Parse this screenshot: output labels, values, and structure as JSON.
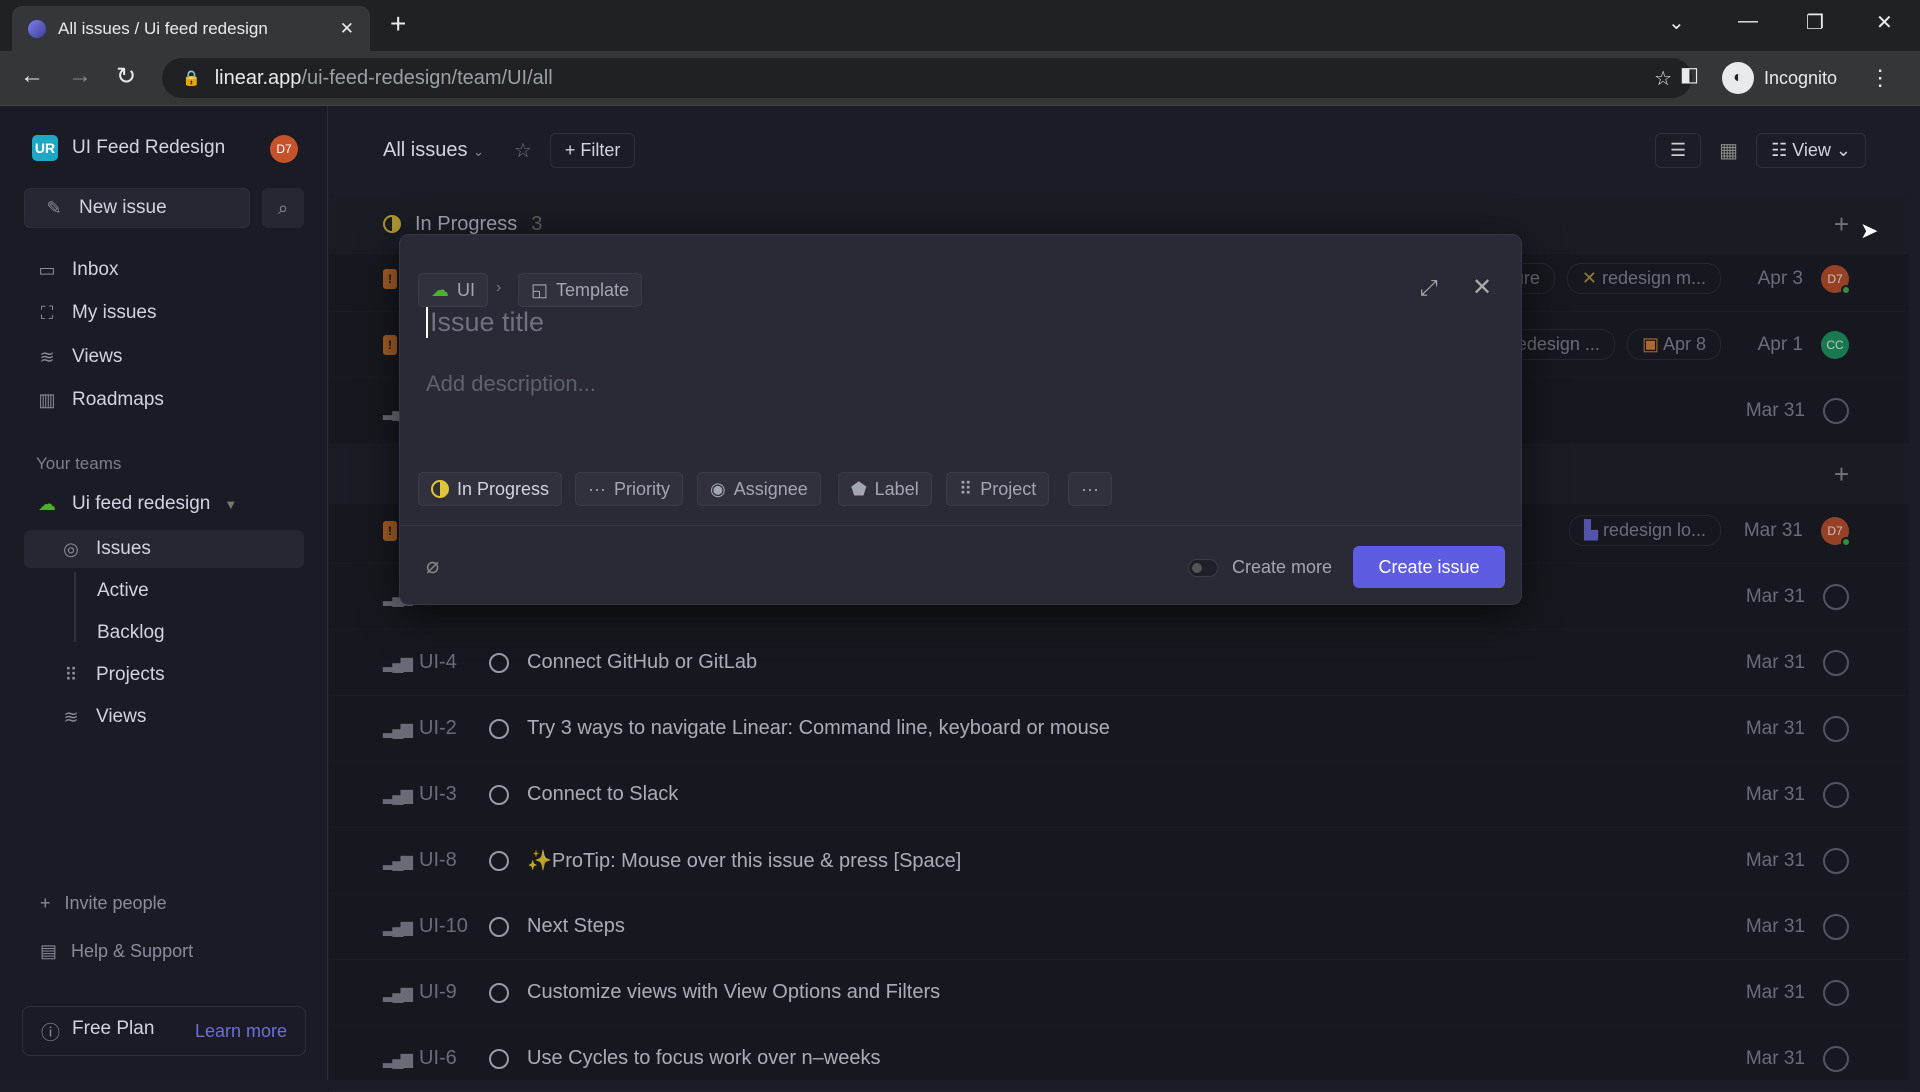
{
  "browser": {
    "tab_title": "All issues / Ui feed redesign",
    "url_host": "linear.app",
    "url_path": "/ui-feed-redesign/team/UI/all",
    "profile": "Incognito"
  },
  "sidebar": {
    "workspace_initials": "UR",
    "workspace": "UI Feed Redesign",
    "user_initials": "D7",
    "new_issue": "New issue",
    "nav": [
      {
        "label": "Inbox",
        "icon": "inbox-icon"
      },
      {
        "label": "My issues",
        "icon": "my-issues-icon"
      },
      {
        "label": "Views",
        "icon": "layers-icon"
      },
      {
        "label": "Roadmaps",
        "icon": "map-icon"
      }
    ],
    "teams_heading": "Your teams",
    "team": "Ui feed redesign",
    "team_items": {
      "issues": "Issues",
      "active": "Active",
      "backlog": "Backlog",
      "projects": "Projects",
      "views": "Views"
    },
    "invite": "Invite people",
    "help": "Help & Support",
    "plan": "Free Plan",
    "learn_more": "Learn more"
  },
  "header": {
    "title": "All issues",
    "filter": "Filter",
    "view": "View"
  },
  "groups": [
    {
      "label": "In Progress",
      "count": "3"
    }
  ],
  "hidden_rows": [
    {
      "chips": [
        "ature",
        "redesign m..."
      ],
      "date": "Apr 3",
      "assignee": "D7",
      "assignee_color": "#c4532c"
    },
    {
      "chips": [
        "Redesign ...",
        "Apr 8"
      ],
      "date": "Apr 1",
      "assignee": "CC",
      "assignee_color": "#1e9e63"
    },
    {
      "chips": [],
      "date": "Mar 31"
    },
    {
      "chips": [
        "redesign lo..."
      ],
      "date": "Mar 31",
      "assignee": "D7",
      "assignee_color": "#c4532c"
    },
    {
      "chips": [],
      "date": "Mar 31"
    }
  ],
  "rows": [
    {
      "id": "UI-4",
      "title": "Connect GitHub or GitLab",
      "date": "Mar 31"
    },
    {
      "id": "UI-2",
      "title": "Try 3 ways to navigate Linear: Command line, keyboard or mouse",
      "date": "Mar 31"
    },
    {
      "id": "UI-3",
      "title": "Connect to Slack",
      "date": "Mar 31"
    },
    {
      "id": "UI-8",
      "title": "✨ProTip: Mouse over this issue & press [Space]",
      "date": "Mar 31"
    },
    {
      "id": "UI-10",
      "title": "Next Steps",
      "date": "Mar 31"
    },
    {
      "id": "UI-9",
      "title": "Customize views with View Options and Filters",
      "date": "Mar 31"
    },
    {
      "id": "UI-6",
      "title": "Use Cycles to focus work over n–weeks",
      "date": "Mar 31"
    }
  ],
  "modal": {
    "team": "UI",
    "template": "Template",
    "title_placeholder": "Issue title",
    "desc_placeholder": "Add description...",
    "props": [
      "In Progress",
      "Priority",
      "Assignee",
      "Label",
      "Project"
    ],
    "create_more": "Create more",
    "create": "Create issue"
  },
  "colors": {
    "accent": "#5e5ce0",
    "in_progress": "#e0c43a",
    "urgent": "#d97a2e"
  }
}
